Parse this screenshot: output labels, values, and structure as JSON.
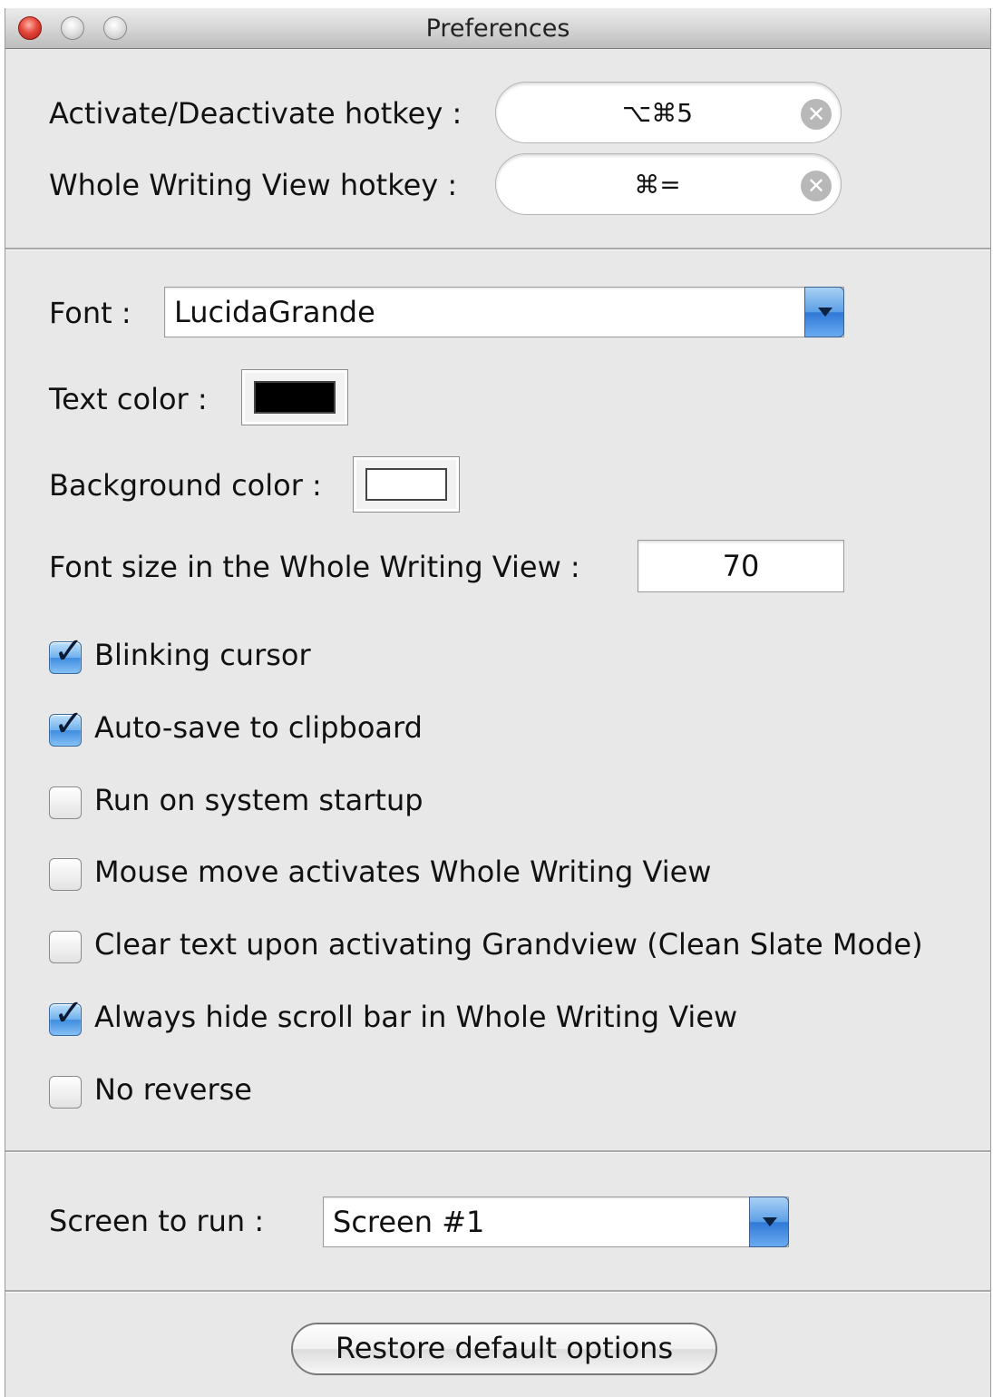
{
  "window": {
    "title": "Preferences"
  },
  "hotkeys": [
    {
      "label": "Activate/Deactivate hotkey :",
      "value": "⌥⌘5"
    },
    {
      "label": "Whole Writing View hotkey :",
      "value": "⌘="
    }
  ],
  "font": {
    "label": "Font :",
    "value": "LucidaGrande"
  },
  "text_color": {
    "label": "Text color :",
    "value": "#000000"
  },
  "background_color": {
    "label": "Background color :",
    "value": "#ffffff"
  },
  "font_size": {
    "label": "Font size in the Whole Writing View :",
    "value": "70"
  },
  "options": [
    {
      "label": "Blinking cursor",
      "checked": true
    },
    {
      "label": "Auto-save to clipboard",
      "checked": true
    },
    {
      "label": "Run on system startup",
      "checked": false
    },
    {
      "label": "Mouse move activates Whole Writing View",
      "checked": false
    },
    {
      "label": "Clear text upon activating Grandview (Clean Slate Mode)",
      "checked": false
    },
    {
      "label": "Always hide scroll bar in Whole Writing View",
      "checked": true
    },
    {
      "label": "No reverse",
      "checked": false
    }
  ],
  "screen": {
    "label": "Screen to run :",
    "value": "Screen #1"
  },
  "restore_button": {
    "label": "Restore default options"
  },
  "icons": {
    "clear": "clear-circle-x-icon",
    "check": "checkmark-icon",
    "popup_arrow": "popup-arrow-icon"
  }
}
